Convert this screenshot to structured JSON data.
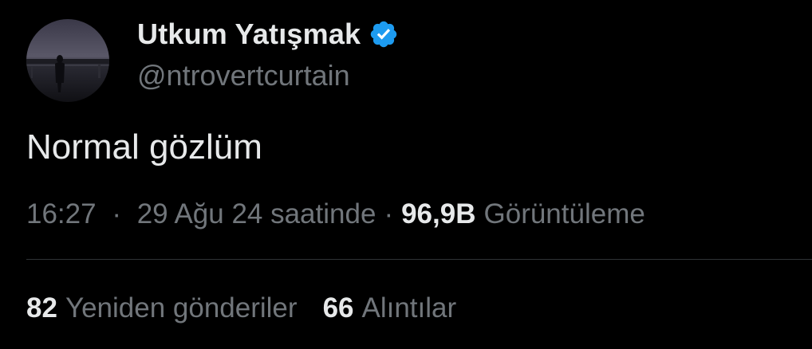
{
  "tweet": {
    "author": {
      "display_name": "Utkum Yatışmak",
      "handle": "@ntrovertcurtain",
      "verified": true,
      "verified_color": "#1d9bf0",
      "avatar_icon": "profile-photo-silhouette"
    },
    "text": "Normal gözlüm",
    "meta": {
      "time": "16:27",
      "separator": "·",
      "date": "29 Ağu 24 saatinde",
      "views_count": "96,9B",
      "views_label": "Görüntüleme"
    },
    "stats": {
      "retweets_count": "82",
      "retweets_label": "Yeniden gönderiler",
      "quotes_count": "66",
      "quotes_label": "Alıntılar"
    }
  },
  "colors": {
    "background": "#000000",
    "primary_text": "#e7e9ea",
    "secondary_text": "#71767b",
    "divider": "#2f3336",
    "accent": "#1d9bf0"
  }
}
